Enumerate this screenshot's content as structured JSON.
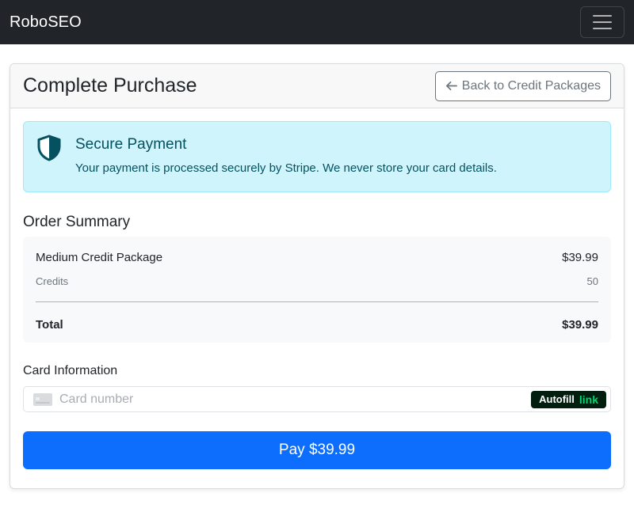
{
  "navbar": {
    "brand": "RoboSEO",
    "menu_icon": "hamburger-icon"
  },
  "header": {
    "title": "Complete Purchase",
    "back_label": "Back to Credit Packages",
    "back_icon": "arrow-left-icon"
  },
  "alert": {
    "icon": "shield-icon",
    "title": "Secure Payment",
    "text": "Your payment is processed securely by Stripe. We never store your card details."
  },
  "summary": {
    "title": "Order Summary",
    "item_label": "Medium Credit Package",
    "item_price": "$39.99",
    "credits_label": "Credits",
    "credits_value": "50",
    "total_label": "Total",
    "total_value": "$39.99"
  },
  "card": {
    "label": "Card Information",
    "placeholder": "Card number",
    "card_icon": "credit-card-icon",
    "autofill_label": "Autofill",
    "autofill_brand": "link"
  },
  "pay_button": "Pay $39.99",
  "colors": {
    "navbar": "#212529",
    "primary": "#0d6efd",
    "alert_bg": "#cff4fc",
    "alert_text": "#055160",
    "autofill_bg": "#011e0f",
    "autofill_link": "#00d66f"
  }
}
